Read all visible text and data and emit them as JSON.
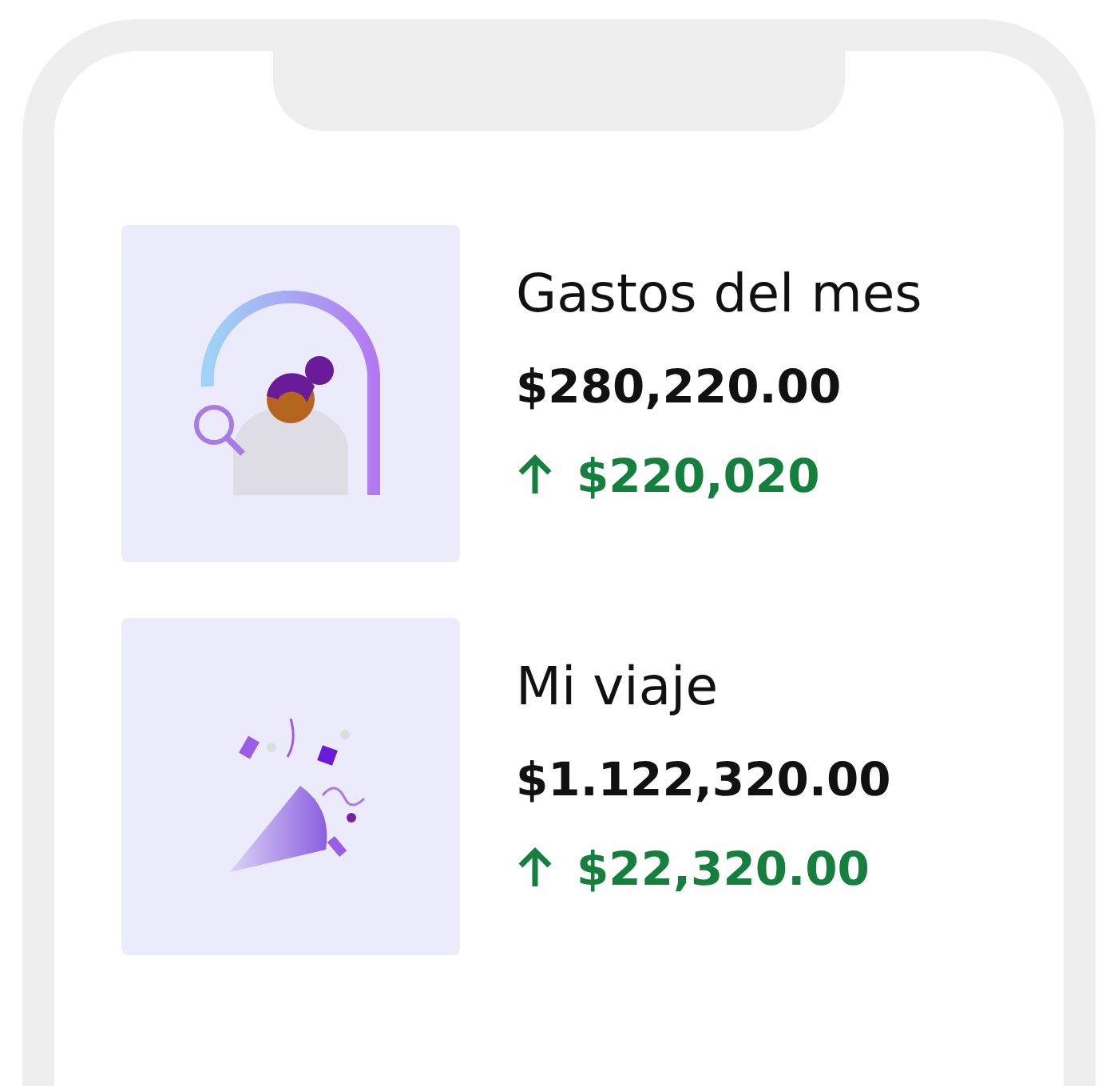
{
  "cards": [
    {
      "kind": "search",
      "title": "Gastos del mes",
      "amount": "$280,220.00",
      "change": "$220,020",
      "rising": true
    },
    {
      "kind": "party",
      "title": "Mi viaje",
      "amount": "$1.122,320.00",
      "change": "$22,320.00",
      "rising": true
    }
  ]
}
